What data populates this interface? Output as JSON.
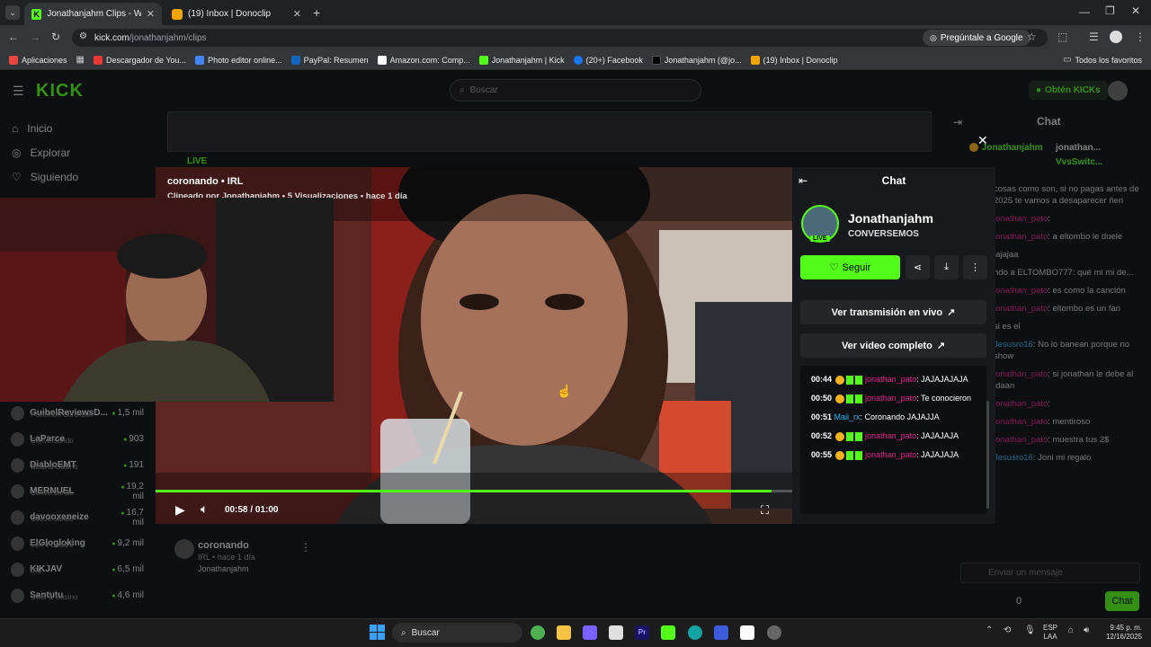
{
  "browser": {
    "tabs": [
      {
        "title": "Jonathanjahm Clips - Watch Liv"
      },
      {
        "title": "(19) Inbox | Donoclip"
      }
    ],
    "url_host": "kick.com",
    "url_path": "/jonathanjahm/clips",
    "ask_google": "Pregúntale a Google",
    "bookmarks": [
      {
        "label": "Aplicaciones",
        "color": "#f28b82"
      },
      {
        "label": "Descargador de You...",
        "color": "#e53935"
      },
      {
        "label": "Photo editor online...",
        "color": "#4285f4"
      },
      {
        "label": "PayPal: Resumen",
        "color": "#1565c0"
      },
      {
        "label": "Amazon.com: Comp...",
        "color": "#ffffff"
      },
      {
        "label": "Jonathanjahm | Kick",
        "color": "#53fc18"
      },
      {
        "label": "(20+) Facebook",
        "color": "#1877f2"
      },
      {
        "label": "Jonathanjahm (@jo...",
        "color": "#000000"
      },
      {
        "label": "(19) Inbox | Donoclip",
        "color": "#f0a500"
      }
    ],
    "all_bookmarks": "Todos los favoritos"
  },
  "kick": {
    "logo": "KICK",
    "search_placeholder": "Buscar",
    "get_kicks": "Obtén KICKs",
    "nav": [
      {
        "label": "Inicio",
        "icon": "home-icon"
      },
      {
        "label": "Explorar",
        "icon": "compass-icon"
      },
      {
        "label": "Siguiendo",
        "icon": "heart-icon"
      }
    ],
    "channels": [
      {
        "name": "GuibelReviewsD...",
        "sub": "Pokemon Ultra Sun",
        "viewers": "1,5 mil"
      },
      {
        "name": "LaParce",
        "sub": "Conversando",
        "viewers": "903"
      },
      {
        "name": "DiabloEMT",
        "sub": "Slots & Casino",
        "viewers": "191"
      },
      {
        "name": "MERNUEL",
        "sub": "Conversando",
        "viewers": "19,2 mil"
      },
      {
        "name": "davooxeneize",
        "sub": "Conversando",
        "viewers": "16,7 mil"
      },
      {
        "name": "ElGlogloking",
        "sub": "Left 4 Dead 2",
        "viewers": "9,2 mil"
      },
      {
        "name": "KIKJAV",
        "sub": "IRL",
        "viewers": "6,5 mil"
      },
      {
        "name": "Santutu",
        "sub": "Slots & Casino",
        "viewers": "4,6 mil"
      }
    ],
    "bg_clip": {
      "title": "coronando",
      "meta": "IRL • hace 1 día",
      "author": "Jonathanjahm",
      "live": "LIVE"
    },
    "right_chat": {
      "header": "Chat",
      "top_users": [
        "Jonathanjahm",
        "jonathan...",
        "VvsSwitc..."
      ],
      "lines": [
        {
          "user": "",
          "text": "cosas como son, si no pagas antes de 2025 te vamos a desaparecer ñeri"
        },
        {
          "user": "jonathan_pato",
          "text": ":"
        },
        {
          "user": "jonathan_pato",
          "text": ": a eltombo le duele"
        },
        {
          "user": "",
          "text": "jajajaa"
        },
        {
          "user": "",
          "text": "ndo a ELTOMBO777: qué mi mi de..."
        },
        {
          "user": "jonathan_pato",
          "text": ": es como la canción"
        },
        {
          "user": "jonathan_pato",
          "text": ": eltombo es un fan"
        },
        {
          "user": "",
          "text": "si es el"
        },
        {
          "user": "Jesusro16",
          "text": ": No lo banean porque no show"
        },
        {
          "user": "jonathan_pato",
          "text": ": si jonathan le debe al ldaan"
        },
        {
          "user": "jonathan_pato",
          "text": ":"
        },
        {
          "user": "jonathan_pato",
          "text": ": mentiroso"
        },
        {
          "user": "jonathan_pato",
          "text": ": muestra tus 2$"
        },
        {
          "user": "Jesusro16",
          "text": ": Joni mi regalo"
        }
      ],
      "input_placeholder": "Enviar un mensaje",
      "points": "0",
      "send": "Chat"
    }
  },
  "clip": {
    "title": "coronando • IRL",
    "subtitle": "Clipeado por Jonathanjahm • 5 Visualizaciones • hace 1 día",
    "time": "00:58 / 01:00",
    "progress": 0.967
  },
  "modal": {
    "chat_title": "Chat",
    "streamer": "Jonathanjahm",
    "stream_title": "CONVERSEMOS",
    "live_badge": "LIVE",
    "follow": "Seguir",
    "watch_live": "Ver transmisión en vivo",
    "watch_full": "Ver video completo",
    "messages": [
      {
        "time": "00:44",
        "user": "jonathan_pato",
        "text": ": JAJAJAJAJA",
        "ucolor": "pink"
      },
      {
        "time": "00:50",
        "user": "jonathan_pato",
        "text": ": Te conocieron",
        "ucolor": "pink"
      },
      {
        "time": "00:51",
        "user": "Maii_rx",
        "text": ": Coronando JAJAJJA",
        "ucolor": "blue"
      },
      {
        "time": "00:52",
        "user": "jonathan_pato",
        "text": ": JAJAJAJA",
        "ucolor": "pink"
      },
      {
        "time": "00:55",
        "user": "jonathan_pato",
        "text": ": JAJAJAJA",
        "ucolor": "pink"
      }
    ]
  },
  "taskbar": {
    "search": "Buscar",
    "lang": "ESP",
    "layout": "LAA",
    "time": "9:45 p. m.",
    "date": "12/16/2025"
  }
}
